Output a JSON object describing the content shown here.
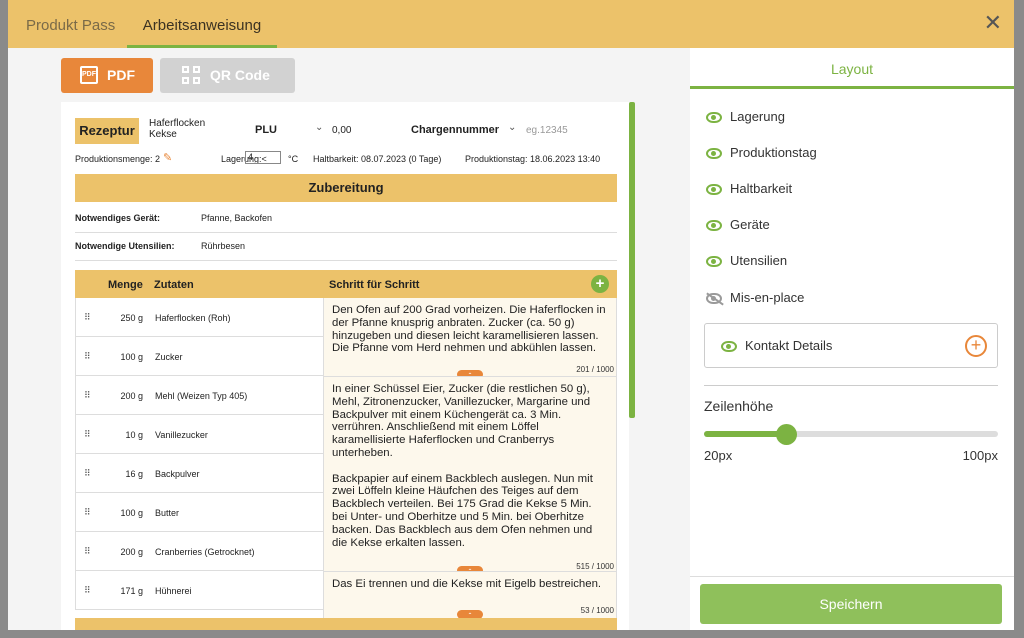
{
  "tabs": [
    {
      "label": "Produkt Pass"
    },
    {
      "label": "Arbeitsanweisung"
    }
  ],
  "close_icon": "close-icon",
  "toolbar": {
    "pdf_label": "PDF",
    "qr_label": "QR Code"
  },
  "header": {
    "rezeptur_label": "Rezeptur",
    "product_name_line1": "Haferflocken",
    "product_name_line2": "Kekse",
    "plu_label": "PLU",
    "plu_value": "0,00",
    "charge_label": "Chargennummer",
    "charge_placeholder": "eg.12345",
    "produktionsmenge": "Produktionsmenge: 2",
    "lagerung_label": "Lagerung:<",
    "lagerung_value": "4",
    "lagerung_unit": "°C",
    "haltbarkeit": "Haltbarkeit:  08.07.2023  (0 Tage)",
    "produktionstag": "Produktionstag:  18.06.2023 13:40"
  },
  "zubereitung_title": "Zubereitung",
  "geraet": {
    "label": "Notwendiges Gerät:",
    "value": "Pfanne, Backofen"
  },
  "utensilien": {
    "label": "Notwendige Utensilien:",
    "value": "Rührbesen"
  },
  "table": {
    "headers": {
      "menge": "Menge",
      "zutaten": "Zutaten",
      "schritt": "Schritt für Schritt"
    },
    "rows": [
      {
        "qty": "250 g",
        "name": "Haferflocken (Roh)"
      },
      {
        "qty": "100 g",
        "name": "Zucker"
      },
      {
        "qty": "200 g",
        "name": "Mehl (Weizen Typ 405)"
      },
      {
        "qty": "10 g",
        "name": "Vanillezucker"
      },
      {
        "qty": "16 g",
        "name": "Backpulver"
      },
      {
        "qty": "100 g",
        "name": "Butter"
      },
      {
        "qty": "200 g",
        "name": "Cranberries (Getrocknet)"
      },
      {
        "qty": "171 g",
        "name": "Hühnerei"
      }
    ],
    "steps": [
      {
        "text": "Den Ofen auf 200 Grad vorheizen. Die Haferflocken in der Pfanne knusprig anbraten. Zucker (ca. 50 g) hinzugeben und diesen leicht karamellisieren lassen. Die Pfanne vom Herd nehmen und abkühlen lassen.",
        "count": "201 / 1000"
      },
      {
        "text": "In einer Schüssel Eier, Zucker (die restlichen 50 g), Mehl, Zitronenzucker, Vanillezucker, Margarine und Backpulver mit einem Küchengerät ca. 3 Min. verrühren. Anschließend mit einem Löffel karamellisierte Haferflocken und Cranberrys unterheben.\n\nBackpapier auf einem Backblech auslegen. Nun mit zwei Löffeln kleine Häufchen des Teiges auf dem Backblech verteilen. Bei 175 Grad die Kekse 5 Min. bei Unter- und Oberhitze und 5 Min. bei Oberhitze backen. Das Backblech aus dem Ofen nehmen und die Kekse erkalten lassen.",
        "count": "515 / 1000"
      },
      {
        "text": "Das Ei trennen und die Kekse mit Eigelb bestreichen.",
        "count": "53 / 1000"
      }
    ],
    "collapse_label": "-"
  },
  "sidebar": {
    "tab_label": "Layout",
    "options": [
      {
        "label": "Lagerung",
        "visible": true
      },
      {
        "label": "Produktionstag",
        "visible": true
      },
      {
        "label": "Haltbarkeit",
        "visible": true
      },
      {
        "label": "Geräte",
        "visible": true
      },
      {
        "label": "Utensilien",
        "visible": true
      },
      {
        "label": "Mis-en-place",
        "visible": false
      }
    ],
    "kontakt_label": "Kontakt Details",
    "zeilenhoehe_label": "Zeilenhöhe",
    "slider_min": "20px",
    "slider_max": "100px",
    "slider_fraction": 0.28,
    "save_label": "Speichern"
  },
  "colors": {
    "accent": "#ecc26a",
    "green": "#7cb342",
    "orange": "#e8873a"
  }
}
